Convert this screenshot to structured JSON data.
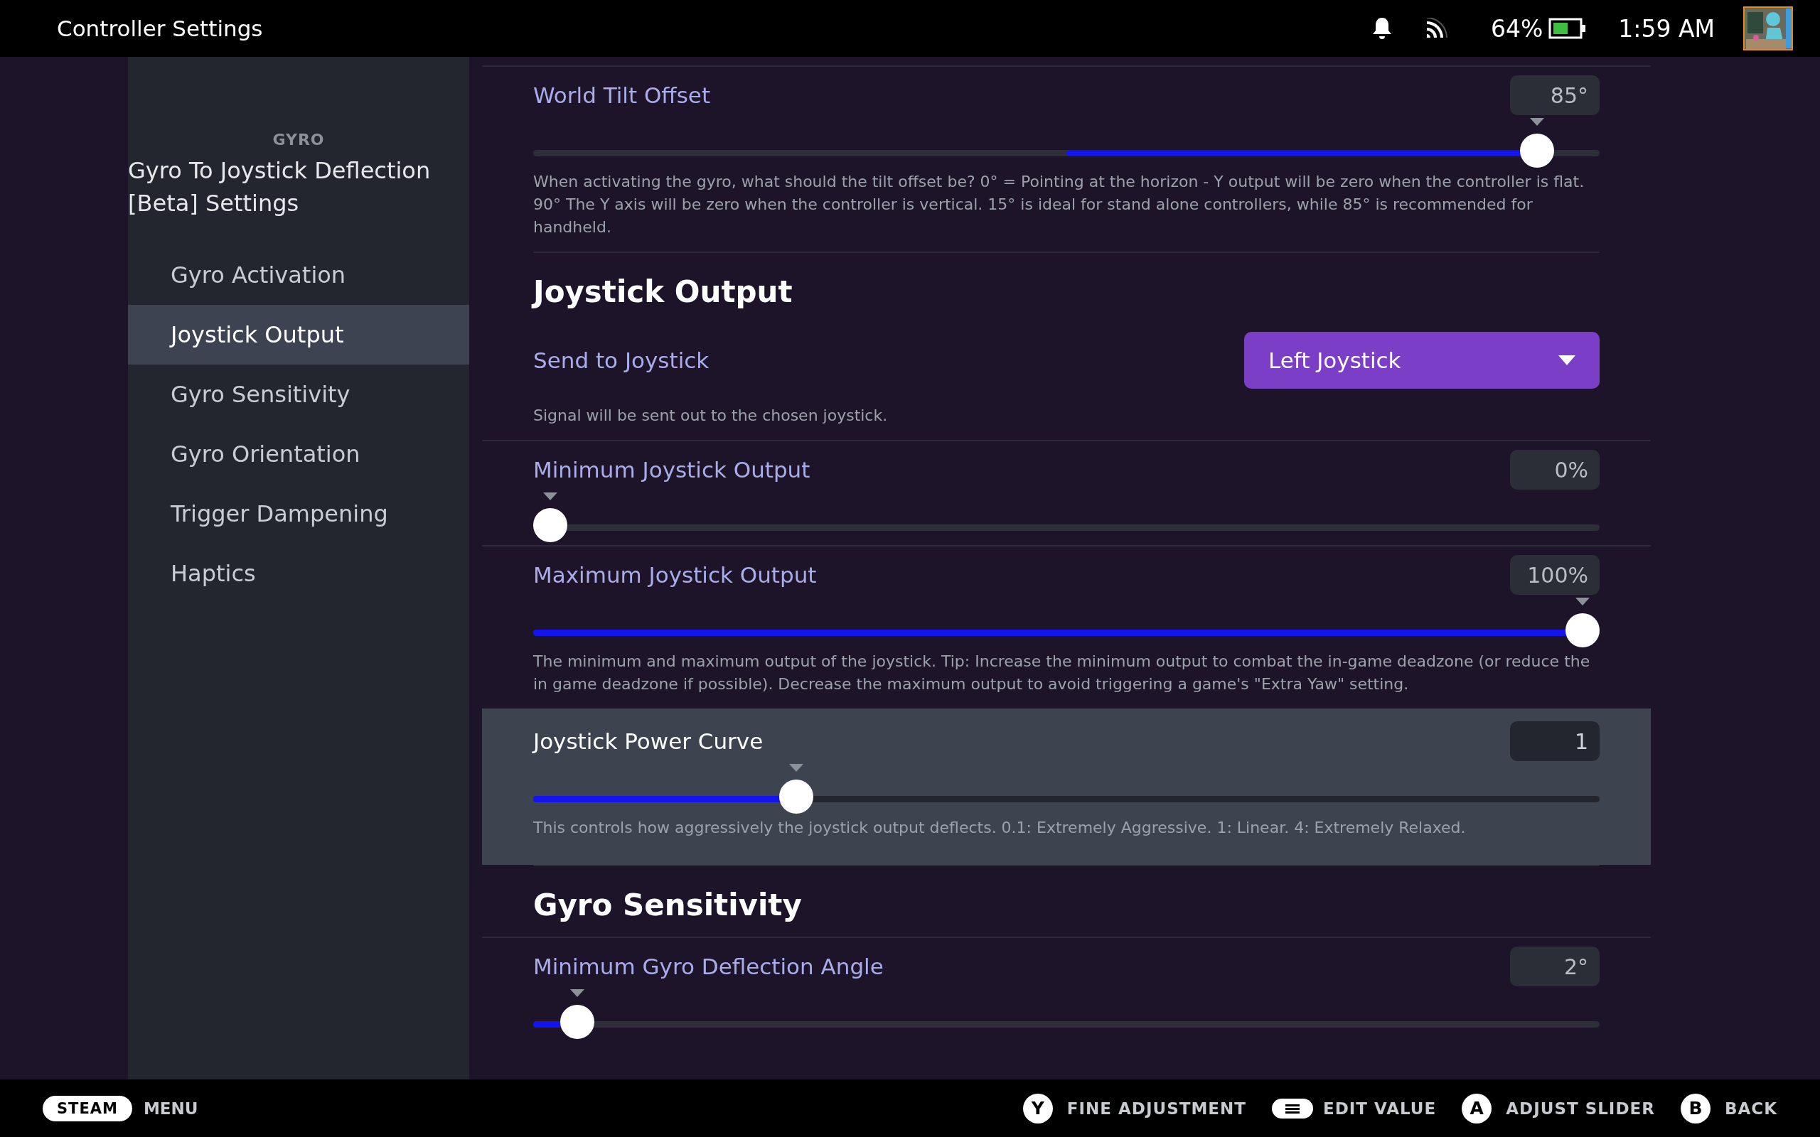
{
  "top_bar": {
    "title": "Controller Settings",
    "battery": "64%",
    "time": "1:59 AM"
  },
  "sidebar": {
    "section": "GYRO",
    "title": "Gyro To Joystick Deflection [Beta] Settings",
    "items": [
      {
        "label": "Gyro Activation",
        "selected": false
      },
      {
        "label": "Joystick Output",
        "selected": true
      },
      {
        "label": "Gyro Sensitivity",
        "selected": false
      },
      {
        "label": "Gyro Orientation",
        "selected": false
      },
      {
        "label": "Trigger Dampening",
        "selected": false
      },
      {
        "label": "Haptics",
        "selected": false
      }
    ]
  },
  "content": {
    "items": [
      {
        "kind": "offset-slider",
        "label": "World Tilt Offset",
        "value": "85°",
        "level": 0.956,
        "focused": false,
        "description": "When activating the gyro, what should the tilt offset be? 0° = Pointing at the horizon - Y output will be zero when the controller is flat. 90° The Y axis will be zero when the controller is vertical. 15° is ideal for stand alone controllers, while 85° is recommended for handheld."
      },
      {
        "kind": "heading",
        "label": "Joystick Output"
      },
      {
        "kind": "dropdown",
        "label": "Send to Joystick",
        "value": "Left Joystick",
        "description": "Signal will be sent out to the chosen joystick."
      },
      {
        "kind": "slider",
        "label": "Minimum Joystick Output",
        "value": "0%",
        "level": 0,
        "focused": false
      },
      {
        "kind": "slider",
        "label": "Maximum Joystick Output",
        "value": "100%",
        "level": 1,
        "focused": false,
        "description": "The minimum and maximum output of the joystick. Tip: Increase the minimum output to combat the in-game deadzone (or reduce the in game deadzone if possible). Decrease the maximum output to avoid triggering a game's \"Extra Yaw\" setting."
      },
      {
        "kind": "slider",
        "label": "Joystick Power Curve",
        "value": "1",
        "level": 0.238,
        "focused": true,
        "description": "This controls how aggressively the joystick output deflects. 0.1: Extremely Aggressive. 1: Linear. 4: Extremely Relaxed."
      },
      {
        "kind": "heading",
        "label": "Gyro Sensitivity"
      },
      {
        "kind": "slider",
        "label": "Minimum Gyro Deflection Angle",
        "value": "2°",
        "level": 0.026,
        "focused": false
      }
    ]
  },
  "footer": {
    "steam": "STEAM",
    "menu": "MENU",
    "hints": [
      {
        "kind": "glyph",
        "button": "Y",
        "label": "FINE ADJUSTMENT"
      },
      {
        "kind": "menu-button",
        "label": "EDIT VALUE"
      },
      {
        "kind": "glyph",
        "button": "A",
        "label": "ADJUST SLIDER"
      },
      {
        "kind": "glyph",
        "button": "B",
        "label": "BACK"
      }
    ]
  }
}
